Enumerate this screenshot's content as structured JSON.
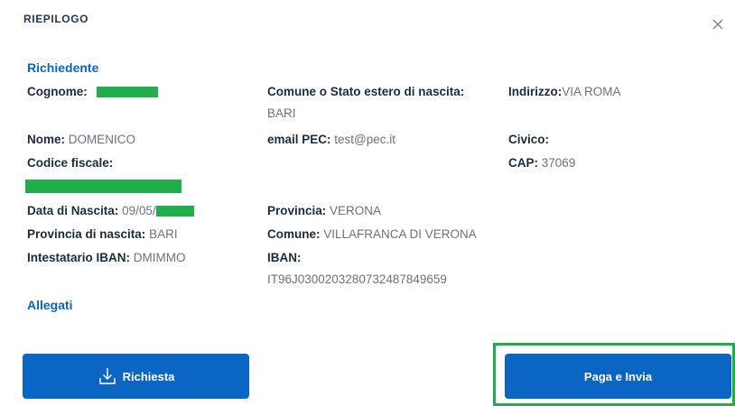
{
  "modal": {
    "title": "RIEPILOGO",
    "close_icon": "close-icon"
  },
  "richiedente": {
    "heading": "Richiedente",
    "cognome_label": "Cognome:",
    "cognome_value": "",
    "comune_nascita_label": "Comune o Stato estero di nascita:",
    "comune_nascita_value": "BARI",
    "indirizzo_label": "Indirizzo:",
    "indirizzo_value": "VIA ROMA",
    "nome_label": "Nome:",
    "nome_value": "DOMENICO",
    "email_label": "email PEC:",
    "email_value": "test@pec.it",
    "civico_label": "Civico:",
    "civico_value": "",
    "codice_fiscale_label": "Codice fiscale:",
    "cap_label": "CAP:",
    "cap_value": "37069",
    "data_nascita_label": "Data di Nascita:",
    "data_nascita_value": "09/05/",
    "provincia_label": "Provincia:",
    "provincia_value": "VERONA",
    "provincia_nascita_label": "Provincia di nascita:",
    "provincia_nascita_value": "BARI",
    "comune_label": "Comune:",
    "comune_value": "VILLAFRANCA DI VERONA",
    "intestatario_label": "Intestatario IBAN:",
    "intestatario_value": "DMIMMO",
    "iban_label": "IBAN:",
    "iban_value": "IT96J0300203280732487849659"
  },
  "allegati": {
    "heading": "Allegati"
  },
  "actions": {
    "richiesta_label": "Richiesta",
    "paga_label": "Paga e Invia"
  },
  "colors": {
    "primary": "#0a66c2",
    "redaction": "#1fae4b",
    "highlight": "#1fae4b"
  }
}
